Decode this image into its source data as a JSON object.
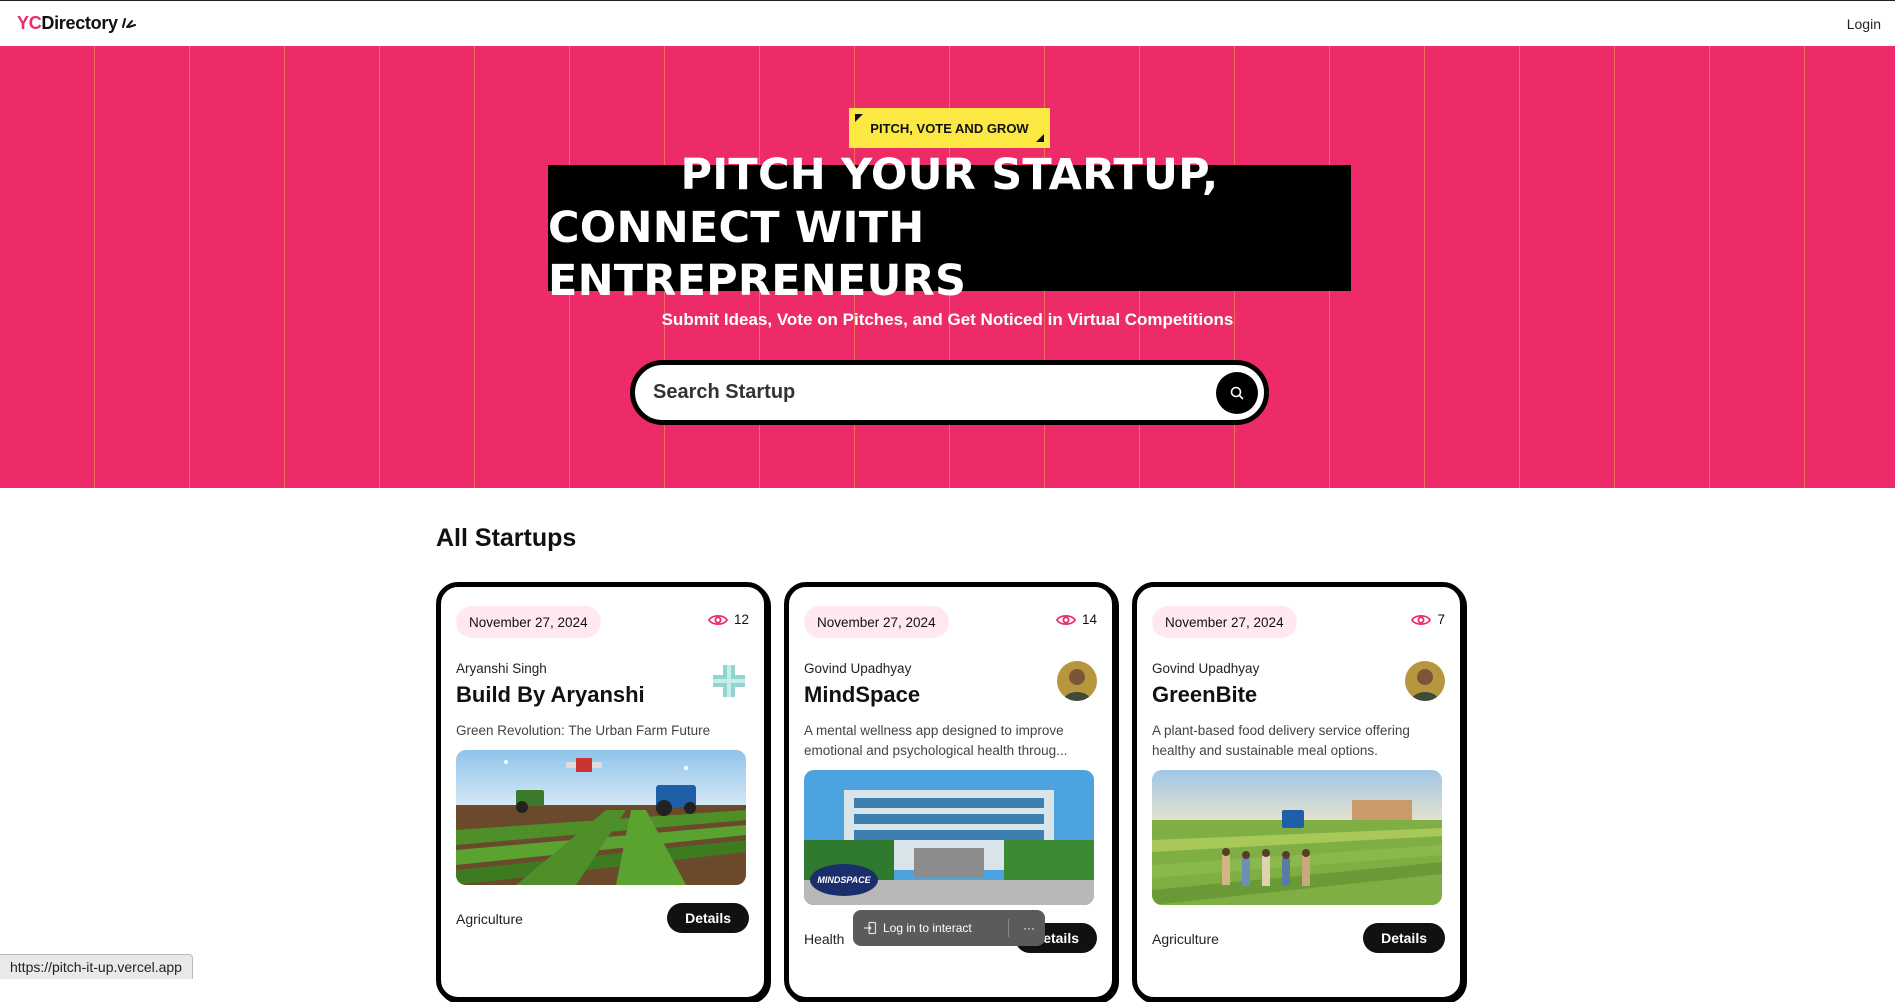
{
  "nav": {
    "logo_yc": "YC",
    "logo_rest": "Directory",
    "login": "Login"
  },
  "hero": {
    "tag": "PITCH, VOTE AND GROW",
    "heading_line1": "PITCH YOUR STARTUP,",
    "heading_line2": "CONNECT WITH ENTREPRENEURS",
    "subtitle": "Submit Ideas, Vote on Pitches, and Get Noticed in Virtual Competitions",
    "search_placeholder": "Search Startup"
  },
  "section_title": "All Startups",
  "cards": [
    {
      "date": "November 27, 2024",
      "views": "12",
      "author": "Aryanshi Singh",
      "title": "Build By Aryanshi",
      "description": "Green Revolution: The Urban Farm Future",
      "category": "Agriculture",
      "details": "Details"
    },
    {
      "date": "November 27, 2024",
      "views": "14",
      "author": "Govind Upadhyay",
      "title": "MindSpace",
      "description": "A mental wellness app designed to improve emotional and psychological health throug...",
      "category": "Health",
      "details": "Details"
    },
    {
      "date": "November 27, 2024",
      "views": "7",
      "author": "Govind Upadhyay",
      "title": "GreenBite",
      "description": "A plant-based food delivery service offering healthy and sustainable meal options.",
      "category": "Agriculture",
      "details": "Details"
    }
  ],
  "status_url": "https://pitch-it-up.vercel.app",
  "toast": {
    "label": "Log in to interact",
    "more": "···"
  },
  "colors": {
    "primary": "#ee2b69",
    "secondary": "#fbe843",
    "dark": "#000000"
  }
}
